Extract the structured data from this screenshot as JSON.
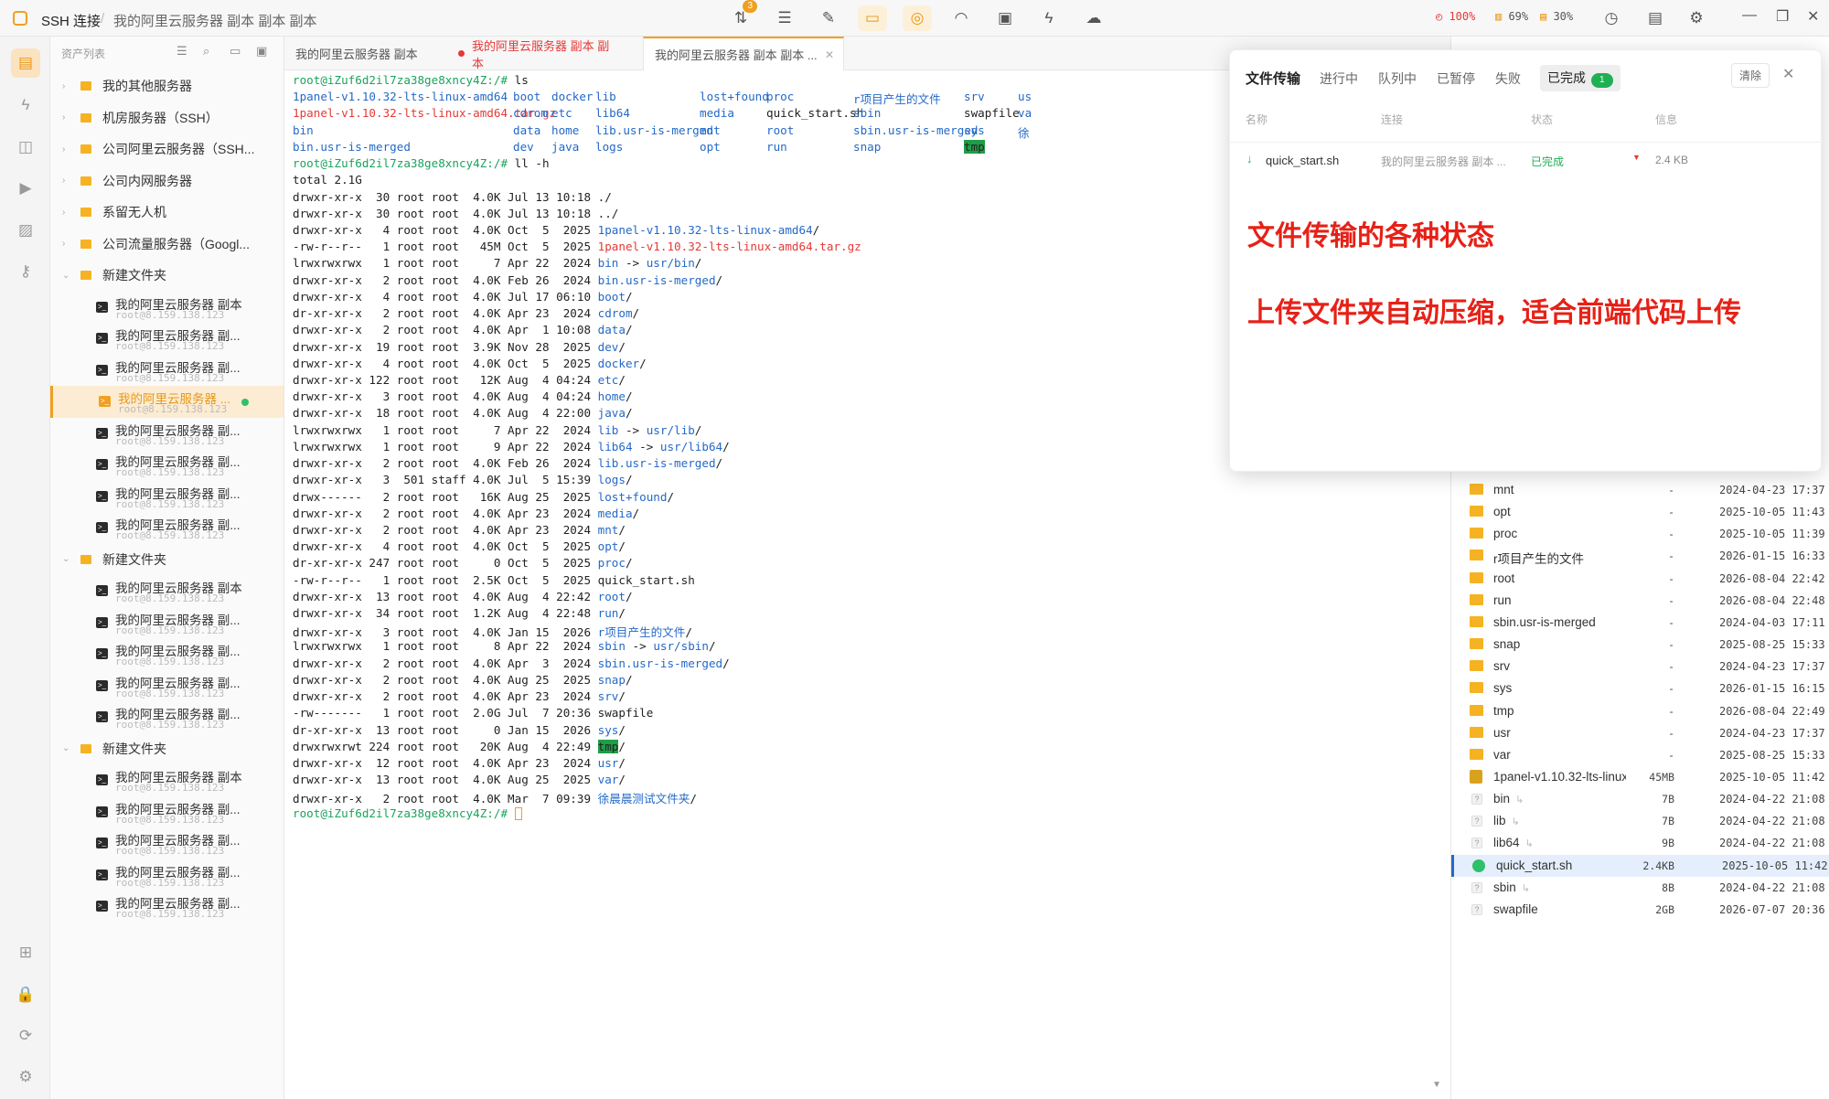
{
  "titlebar": {
    "app_title": "SSH 连接",
    "breadcrumb": "我的阿里云服务器 副本 副本 副本",
    "transfer_badge": "3",
    "stats": {
      "cpu": "100%",
      "mem": "69%",
      "disk": "30%"
    },
    "colors": {
      "cpu": "#e53935",
      "mem": "#e8981a",
      "disk": "#e8981a"
    }
  },
  "sidebar": {
    "header": "资产列表",
    "groups": [
      {
        "label": "我的其他服务器"
      },
      {
        "label": "机房服务器（SSH）"
      },
      {
        "label": "公司阿里云服务器（SSH..."
      },
      {
        "label": "公司内网服务器"
      },
      {
        "label": "系留无人机"
      },
      {
        "label": "公司流量服务器（Googl..."
      }
    ],
    "folders": [
      {
        "label": "新建文件夹",
        "servers": [
          {
            "name": "我的阿里云服务器 副本",
            "host": "root@8.159.138.123"
          },
          {
            "name": "我的阿里云服务器 副...",
            "host": "root@8.159.138.123"
          },
          {
            "name": "我的阿里云服务器 副...",
            "host": "root@8.159.138.123"
          },
          {
            "name": "我的阿里云服务器 ...",
            "host": "root@8.159.138.123"
          },
          {
            "name": "我的阿里云服务器 副...",
            "host": "root@8.159.138.123"
          },
          {
            "name": "我的阿里云服务器 副...",
            "host": "root@8.159.138.123"
          },
          {
            "name": "我的阿里云服务器 副...",
            "host": "root@8.159.138.123"
          },
          {
            "name": "我的阿里云服务器 副...",
            "host": "root@8.159.138.123"
          }
        ]
      },
      {
        "label": "新建文件夹",
        "servers": [
          {
            "name": "我的阿里云服务器 副本",
            "host": "root@8.159.138.123"
          },
          {
            "name": "我的阿里云服务器 副...",
            "host": "root@8.159.138.123"
          },
          {
            "name": "我的阿里云服务器 副...",
            "host": "root@8.159.138.123"
          },
          {
            "name": "我的阿里云服务器 副...",
            "host": "root@8.159.138.123"
          },
          {
            "name": "我的阿里云服务器 副...",
            "host": "root@8.159.138.123"
          }
        ]
      },
      {
        "label": "新建文件夹",
        "servers": [
          {
            "name": "我的阿里云服务器 副本",
            "host": "root@8.159.138.123"
          },
          {
            "name": "我的阿里云服务器 副...",
            "host": "root@8.159.138.123"
          },
          {
            "name": "我的阿里云服务器 副...",
            "host": "root@8.159.138.123"
          },
          {
            "name": "我的阿里云服务器 副...",
            "host": "root@8.159.138.123"
          },
          {
            "name": "我的阿里云服务器 副...",
            "host": "root@8.159.138.123"
          }
        ]
      }
    ]
  },
  "tabs": [
    {
      "label": "我的阿里云服务器 副本"
    },
    {
      "label": "我的阿里云服务器 副本 副本"
    },
    {
      "label": "我的阿里云服务器 副本 副本 ..."
    }
  ],
  "terminal": {
    "prompt": "root@iZuf6d2il7za38ge8xncy4Z:/#",
    "cmd1": " ls",
    "ls_rows": [
      [
        {
          "t": "1panel-v1.10.32-lts-linux-amd64",
          "c": "blue"
        },
        {
          "t": "boot",
          "c": "blue"
        },
        {
          "t": "docker",
          "c": "blue"
        },
        {
          "t": "lib",
          "c": "blue"
        },
        {
          "t": "lost+found",
          "c": "blue"
        },
        {
          "t": "proc",
          "c": "blue"
        },
        {
          "t": "r项目产生的文件",
          "c": "blue"
        },
        {
          "t": "srv",
          "c": "blue"
        },
        {
          "t": "us",
          "c": "blue"
        }
      ],
      [
        {
          "t": "1panel-v1.10.32-lts-linux-amd64.tar.gz",
          "c": "red"
        },
        {
          "t": "cdrom",
          "c": "blue"
        },
        {
          "t": "etc",
          "c": "blue"
        },
        {
          "t": "lib64",
          "c": "blue"
        },
        {
          "t": "media",
          "c": "blue"
        },
        {
          "t": "quick_start.sh",
          "c": ""
        },
        {
          "t": "sbin",
          "c": "blue"
        },
        {
          "t": "swapfile",
          "c": ""
        },
        {
          "t": "va",
          "c": "blue"
        }
      ],
      [
        {
          "t": "bin",
          "c": "blue"
        },
        {
          "t": "data",
          "c": "blue"
        },
        {
          "t": "home",
          "c": "blue"
        },
        {
          "t": "lib.usr-is-merged",
          "c": "blue"
        },
        {
          "t": "mnt",
          "c": "blue"
        },
        {
          "t": "root",
          "c": "blue"
        },
        {
          "t": "sbin.usr-is-merged",
          "c": "blue"
        },
        {
          "t": "sys",
          "c": "blue"
        },
        {
          "t": "徐",
          "c": "blue"
        }
      ],
      [
        {
          "t": "bin.usr-is-merged",
          "c": "blue"
        },
        {
          "t": "dev",
          "c": "blue"
        },
        {
          "t": "java",
          "c": "blue"
        },
        {
          "t": "logs",
          "c": "blue"
        },
        {
          "t": "opt",
          "c": "blue"
        },
        {
          "t": "run",
          "c": "blue"
        },
        {
          "t": "snap",
          "c": "blue"
        },
        {
          "t": "tmp",
          "c": "hl"
        },
        {
          "t": "",
          "c": ""
        }
      ]
    ],
    "cmd2": " ll -h",
    "total": "total 2.1G",
    "ll": [
      {
        "p": "drwxr-xr-x  30 root root  4.0K Jul 13 10:18 ",
        "n": "./",
        "c": ""
      },
      {
        "p": "drwxr-xr-x  30 root root  4.0K Jul 13 10:18 ",
        "n": "../",
        "c": ""
      },
      {
        "p": "drwxr-xr-x   4 root root  4.0K Oct  5  2025 ",
        "n": "1panel-v1.10.32-lts-linux-amd64",
        "c": "blue",
        "s": "/"
      },
      {
        "p": "-rw-r--r--   1 root root   45M Oct  5  2025 ",
        "n": "1panel-v1.10.32-lts-linux-amd64.tar.gz",
        "c": "red"
      },
      {
        "p": "lrwxrwxrwx   1 root root     7 Apr 22  2024 ",
        "n": "bin",
        "c": "blue",
        "s": " -> ",
        "t": "usr/bin",
        "tc": "blue",
        "ts": "/"
      },
      {
        "p": "drwxr-xr-x   2 root root  4.0K Feb 26  2024 ",
        "n": "bin.usr-is-merged",
        "c": "blue",
        "s": "/"
      },
      {
        "p": "drwxr-xr-x   4 root root  4.0K Jul 17 06:10 ",
        "n": "boot",
        "c": "blue",
        "s": "/"
      },
      {
        "p": "dr-xr-xr-x   2 root root  4.0K Apr 23  2024 ",
        "n": "cdrom",
        "c": "blue",
        "s": "/"
      },
      {
        "p": "drwxr-xr-x   2 root root  4.0K Apr  1 10:08 ",
        "n": "data",
        "c": "blue",
        "s": "/"
      },
      {
        "p": "drwxr-xr-x  19 root root  3.9K Nov 28  2025 ",
        "n": "dev",
        "c": "blue",
        "s": "/"
      },
      {
        "p": "drwxr-xr-x   4 root root  4.0K Oct  5  2025 ",
        "n": "docker",
        "c": "blue",
        "s": "/"
      },
      {
        "p": "drwxr-xr-x 122 root root   12K Aug  4 04:24 ",
        "n": "etc",
        "c": "blue",
        "s": "/"
      },
      {
        "p": "drwxr-xr-x   3 root root  4.0K Aug  4 04:24 ",
        "n": "home",
        "c": "blue",
        "s": "/"
      },
      {
        "p": "drwxr-xr-x  18 root root  4.0K Aug  4 22:00 ",
        "n": "java",
        "c": "blue",
        "s": "/"
      },
      {
        "p": "lrwxrwxrwx   1 root root     7 Apr 22  2024 ",
        "n": "lib",
        "c": "blue",
        "s": " -> ",
        "t": "usr/lib",
        "tc": "blue",
        "ts": "/"
      },
      {
        "p": "lrwxrwxrwx   1 root root     9 Apr 22  2024 ",
        "n": "lib64",
        "c": "blue",
        "s": " -> ",
        "t": "usr/lib64",
        "tc": "blue",
        "ts": "/"
      },
      {
        "p": "drwxr-xr-x   2 root root  4.0K Feb 26  2024 ",
        "n": "lib.usr-is-merged",
        "c": "blue",
        "s": "/"
      },
      {
        "p": "drwxr-xr-x   3  501 staff 4.0K Jul  5 15:39 ",
        "n": "logs",
        "c": "blue",
        "s": "/"
      },
      {
        "p": "drwx------   2 root root   16K Aug 25  2025 ",
        "n": "lost+found",
        "c": "blue",
        "s": "/"
      },
      {
        "p": "drwxr-xr-x   2 root root  4.0K Apr 23  2024 ",
        "n": "media",
        "c": "blue",
        "s": "/"
      },
      {
        "p": "drwxr-xr-x   2 root root  4.0K Apr 23  2024 ",
        "n": "mnt",
        "c": "blue",
        "s": "/"
      },
      {
        "p": "drwxr-xr-x   4 root root  4.0K Oct  5  2025 ",
        "n": "opt",
        "c": "blue",
        "s": "/"
      },
      {
        "p": "dr-xr-xr-x 247 root root     0 Oct  5  2025 ",
        "n": "proc",
        "c": "blue",
        "s": "/"
      },
      {
        "p": "-rw-r--r--   1 root root  2.5K Oct  5  2025 ",
        "n": "quick_start.sh",
        "c": ""
      },
      {
        "p": "drwxr-xr-x  13 root root  4.0K Aug  4 22:42 ",
        "n": "root",
        "c": "blue",
        "s": "/"
      },
      {
        "p": "drwxr-xr-x  34 root root  1.2K Aug  4 22:48 ",
        "n": "run",
        "c": "blue",
        "s": "/"
      },
      {
        "p": "drwxr-xr-x   3 root root  4.0K Jan 15  2026 ",
        "n": "r项目产生的文件",
        "c": "blue",
        "s": "/"
      },
      {
        "p": "lrwxrwxrwx   1 root root     8 Apr 22  2024 ",
        "n": "sbin",
        "c": "blue",
        "s": " -> ",
        "t": "usr/sbin",
        "tc": "blue",
        "ts": "/"
      },
      {
        "p": "drwxr-xr-x   2 root root  4.0K Apr  3  2024 ",
        "n": "sbin.usr-is-merged",
        "c": "blue",
        "s": "/"
      },
      {
        "p": "drwxr-xr-x   2 root root  4.0K Aug 25  2025 ",
        "n": "snap",
        "c": "blue",
        "s": "/"
      },
      {
        "p": "drwxr-xr-x   2 root root  4.0K Apr 23  2024 ",
        "n": "srv",
        "c": "blue",
        "s": "/"
      },
      {
        "p": "-rw-------   1 root root  2.0G Jul  7 20:36 ",
        "n": "swapfile",
        "c": ""
      },
      {
        "p": "dr-xr-xr-x  13 root root     0 Jan 15  2026 ",
        "n": "sys",
        "c": "blue",
        "s": "/"
      },
      {
        "p": "drwxrwxrwt 224 root root   20K Aug  4 22:49 ",
        "n": "tmp",
        "c": "hl",
        "s": "/"
      },
      {
        "p": "drwxr-xr-x  12 root root  4.0K Apr 23  2024 ",
        "n": "usr",
        "c": "blue",
        "s": "/"
      },
      {
        "p": "drwxr-xr-x  13 root root  4.0K Aug 25  2025 ",
        "n": "var",
        "c": "blue",
        "s": "/"
      },
      {
        "p": "drwxr-xr-x   2 root root  4.0K Mar  7 09:39 ",
        "n": "徐晨晨测试文件夹",
        "c": "blue",
        "s": "/"
      }
    ]
  },
  "transfer": {
    "title": "文件传输",
    "tabs": [
      "进行中",
      "队列中",
      "已暂停",
      "失败"
    ],
    "active_tab": "已完成",
    "active_count": "1",
    "clear": "清除",
    "columns": {
      "name": "名称",
      "conn": "连接",
      "status": "状态",
      "info": "信息"
    },
    "row": {
      "file": "quick_start.sh",
      "conn": "我的阿里云服务器 副本 ...",
      "status": "已完成",
      "info": "2.4 KB"
    },
    "note1": "文件传输的各种状态",
    "note2": "上传文件夹自动压缩，适合前端代码上传"
  },
  "files": [
    {
      "name": "mnt",
      "size": "-",
      "date": "2024-04-23 17:37",
      "icon": "folder"
    },
    {
      "name": "opt",
      "size": "-",
      "date": "2025-10-05 11:43",
      "icon": "folder"
    },
    {
      "name": "proc",
      "size": "-",
      "date": "2025-10-05 11:39",
      "icon": "folder"
    },
    {
      "name": "r项目产生的文件",
      "size": "-",
      "date": "2026-01-15 16:33",
      "icon": "folder"
    },
    {
      "name": "root",
      "size": "-",
      "date": "2026-08-04 22:42",
      "icon": "folder"
    },
    {
      "name": "run",
      "size": "-",
      "date": "2026-08-04 22:48",
      "icon": "folder"
    },
    {
      "name": "sbin.usr-is-merged",
      "size": "-",
      "date": "2024-04-03 17:11",
      "icon": "folder"
    },
    {
      "name": "snap",
      "size": "-",
      "date": "2025-08-25 15:33",
      "icon": "folder"
    },
    {
      "name": "srv",
      "size": "-",
      "date": "2024-04-23 17:37",
      "icon": "folder"
    },
    {
      "name": "sys",
      "size": "-",
      "date": "2026-01-15 16:15",
      "icon": "folder"
    },
    {
      "name": "tmp",
      "size": "-",
      "date": "2026-08-04 22:49",
      "icon": "folder"
    },
    {
      "name": "usr",
      "size": "-",
      "date": "2024-04-23 17:37",
      "icon": "folder"
    },
    {
      "name": "var",
      "size": "-",
      "date": "2025-08-25 15:33",
      "icon": "folder"
    },
    {
      "name": "1panel-v1.10.32-lts-linux-am",
      "size": "45MB",
      "date": "2025-10-05 11:42",
      "icon": "archive"
    },
    {
      "name": "bin",
      "size": "7B",
      "date": "2024-04-22 21:08",
      "icon": "unknown",
      "link": true
    },
    {
      "name": "lib",
      "size": "7B",
      "date": "2024-04-22 21:08",
      "icon": "unknown",
      "link": true
    },
    {
      "name": "lib64",
      "size": "9B",
      "date": "2024-04-22 21:08",
      "icon": "unknown",
      "link": true
    },
    {
      "name": "quick_start.sh",
      "size": "2.4KB",
      "date": "2025-10-05 11:42",
      "icon": "script",
      "selected": true
    },
    {
      "name": "sbin",
      "size": "8B",
      "date": "2024-04-22 21:08",
      "icon": "unknown",
      "link": true
    },
    {
      "name": "swapfile",
      "size": "2GB",
      "date": "2026-07-07 20:36",
      "icon": "unknown"
    }
  ]
}
